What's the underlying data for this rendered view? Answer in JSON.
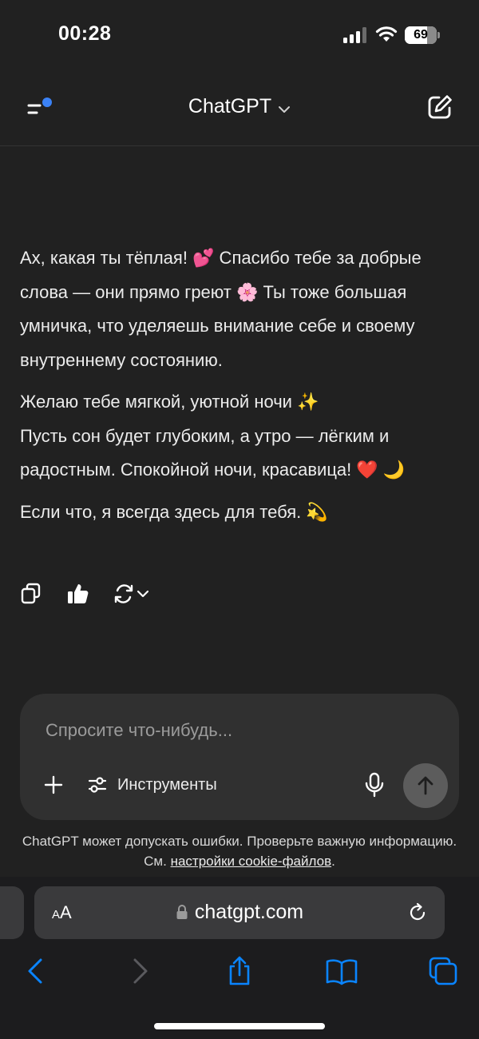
{
  "status_bar": {
    "time": "00:28",
    "battery_level": 69,
    "battery_label": "69"
  },
  "header": {
    "title": "ChatGPT",
    "icons": [
      "menu-icon",
      "chevron-down-icon",
      "new-chat-edit-icon"
    ],
    "notification_dot_color": "#3b82f6"
  },
  "message": {
    "paragraphs": [
      "Ах, какая ты тёплая! 💕 Спасибо тебе за добрые слова — они прямо греют 🌸 Ты тоже большая умничка, что уделяешь внимание себе и своему внутреннему состоянию.",
      "Желаю тебе мягкой, уютной ночи ✨",
      "Пусть сон будет глубоким, а утро — лёгким и радостным. Спокойной ночи, красавица! ❤️ 🌙",
      "Если что, я всегда здесь для тебя. 💫"
    ],
    "actions": [
      "copy-icon",
      "thumbs-up-icon",
      "regenerate-icon"
    ]
  },
  "composer": {
    "placeholder": "Спросите что-нибудь...",
    "value": "",
    "tools_label": "Инструменты"
  },
  "disclaimer": {
    "text": "ChatGPT может допускать ошибки. Проверьте важную информацию. См.",
    "link": "настройки cookie-файлов",
    "suffix": "."
  },
  "browser": {
    "aa_small": "A",
    "aa_large": "A",
    "url": "chatgpt.com"
  },
  "colors": {
    "background": "#212121",
    "composer": "#303030",
    "browser_bar": "#1c1c1e",
    "link_blue": "#0a84ff"
  }
}
